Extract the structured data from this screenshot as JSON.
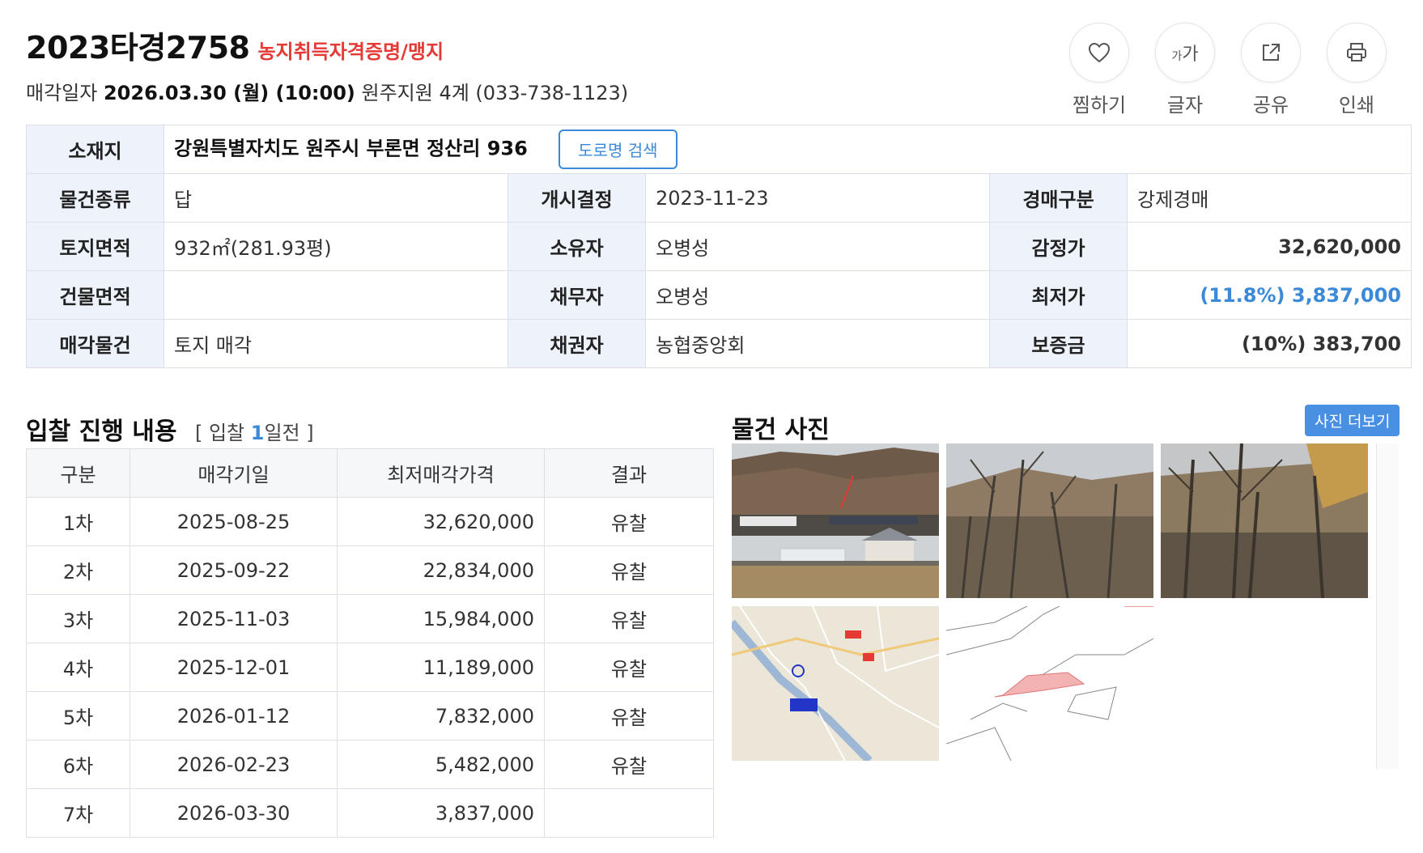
{
  "header": {
    "case_no": "2023타경2758",
    "tag": "농지취득자격증명/맹지",
    "sale_label": "매각일자",
    "sale_date": "2026.03.30 (월) (10:00)",
    "court": "원주지원 4계 (033-738-1123)"
  },
  "actions": [
    {
      "label": "찜하기",
      "icon": "heart-icon"
    },
    {
      "label": "글자",
      "icon": "font-size-icon",
      "glyph_small": "가",
      "glyph_big": "가"
    },
    {
      "label": "공유",
      "icon": "share-icon"
    },
    {
      "label": "인쇄",
      "icon": "print-icon"
    }
  ],
  "info": {
    "address_label": "소재지",
    "address": "강원특별자치도 원주시 부론면 정산리 936",
    "road_button": "도로명 검색",
    "rows": [
      [
        {
          "k": "물건종류",
          "v": "답"
        },
        {
          "k": "개시결정",
          "v": "2023-11-23"
        },
        {
          "k": "경매구분",
          "v": "강제경매"
        }
      ],
      [
        {
          "k": "토지면적",
          "v": "932㎡(281.93평)"
        },
        {
          "k": "소유자",
          "v": "오병성"
        },
        {
          "k": "감정가",
          "v": "32,620,000"
        }
      ],
      [
        {
          "k": "건물면적",
          "v": ""
        },
        {
          "k": "채무자",
          "v": "오병성"
        },
        {
          "k": "최저가",
          "v": "(11.8%) 3,837,000"
        }
      ],
      [
        {
          "k": "매각물건",
          "v": "토지 매각"
        },
        {
          "k": "채권자",
          "v": "농협중앙회"
        },
        {
          "k": "보증금",
          "v": "(10%) 383,700"
        }
      ]
    ]
  },
  "bid": {
    "title": "입찰 진행 내용",
    "sub_prefix": "[ 입찰 ",
    "sub_num": "1",
    "sub_suffix": "일전 ]",
    "headers": [
      "구분",
      "매각기일",
      "최저매각가격",
      "결과"
    ],
    "rows": [
      [
        "1차",
        "2025-08-25",
        "32,620,000",
        "유찰"
      ],
      [
        "2차",
        "2025-09-22",
        "22,834,000",
        "유찰"
      ],
      [
        "3차",
        "2025-11-03",
        "15,984,000",
        "유찰"
      ],
      [
        "4차",
        "2025-12-01",
        "11,189,000",
        "유찰"
      ],
      [
        "5차",
        "2026-01-12",
        "7,832,000",
        "유찰"
      ],
      [
        "6차",
        "2026-02-23",
        "5,482,000",
        "유찰"
      ],
      [
        "7차",
        "2026-03-30",
        "3,837,000",
        ""
      ]
    ]
  },
  "photos": {
    "title": "물건 사진",
    "more": "사진 더보기",
    "items": [
      "site-photo",
      "brush-photo",
      "trees-photo",
      "location-map",
      "cadastral-map"
    ]
  },
  "colors": {
    "accent": "#3b8ad9",
    "tag_red": "#e53935",
    "header_bg": "#eef3fb"
  }
}
